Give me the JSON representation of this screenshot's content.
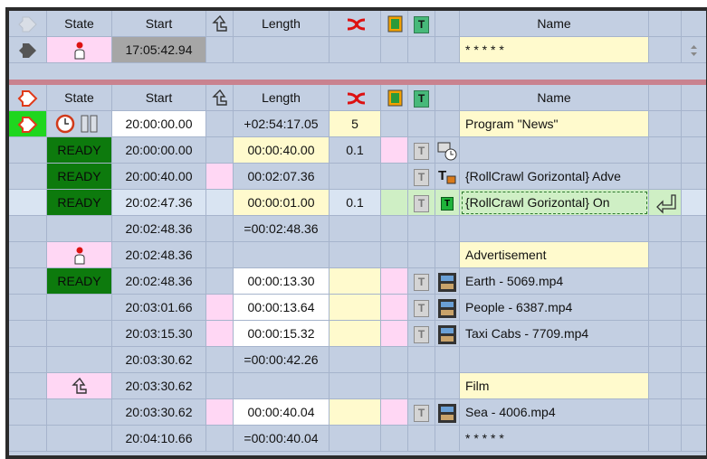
{
  "headers": {
    "state": "State",
    "start": "Start",
    "length": "Length",
    "name": "Name"
  },
  "top_row": {
    "start": "17:05:42.94",
    "name": "* * * * *"
  },
  "rows": [
    {
      "state": "",
      "start": "20:00:00.00",
      "length": "+02:54:17.05",
      "num": "5",
      "name": "Program \"News\""
    },
    {
      "state": "READY",
      "start": "20:00:00.00",
      "length": "00:00:40.00",
      "num": "0.1",
      "name": ""
    },
    {
      "state": "READY",
      "start": "20:00:40.00",
      "length": "00:02:07.36",
      "num": "",
      "name": "{RollCrawl Gorizontal} Adve"
    },
    {
      "state": "READY",
      "start": "20:02:47.36",
      "length": "00:00:01.00",
      "num": "0.1",
      "name": "{RollCrawl Gorizontal} On"
    },
    {
      "state": "",
      "start": "20:02:48.36",
      "length": "=00:02:48.36",
      "num": "",
      "name": ""
    },
    {
      "state": "",
      "start": "20:02:48.36",
      "length": "",
      "num": "",
      "name": "Advertisement"
    },
    {
      "state": "READY",
      "start": "20:02:48.36",
      "length": "00:00:13.30",
      "num": "",
      "name": "Earth - 5069.mp4"
    },
    {
      "state": "",
      "start": "20:03:01.66",
      "length": "00:00:13.64",
      "num": "",
      "name": "People - 6387.mp4"
    },
    {
      "state": "",
      "start": "20:03:15.30",
      "length": "00:00:15.32",
      "num": "",
      "name": "Taxi Cabs - 7709.mp4"
    },
    {
      "state": "",
      "start": "20:03:30.62",
      "length": "=00:00:42.26",
      "num": "",
      "name": ""
    },
    {
      "state": "",
      "start": "20:03:30.62",
      "length": "",
      "num": "",
      "name": "Film"
    },
    {
      "state": "",
      "start": "20:03:30.62",
      "length": "00:00:40.04",
      "num": "",
      "name": "Sea - 4006.mp4"
    },
    {
      "state": "",
      "start": "20:04:10.66",
      "length": "=00:00:40.04",
      "num": "",
      "name": "* * * * *"
    }
  ],
  "icons": {
    "t_label": "T",
    "pause": "pause-icon",
    "clock": "clock-icon",
    "film": "film-icon",
    "shuffle": "shuffle-icon",
    "hand": "hand-pointer-icon",
    "arrow": "play-arrow-icon",
    "up": "up-return-icon"
  },
  "colors": {
    "ready_bg": "#0d7a0d",
    "yellow": "#fffacd",
    "pink": "#ffd7f4",
    "grid_bg": "#c3cfe2",
    "separator": "#c9828f",
    "selected_row": "#d9e4f2"
  }
}
